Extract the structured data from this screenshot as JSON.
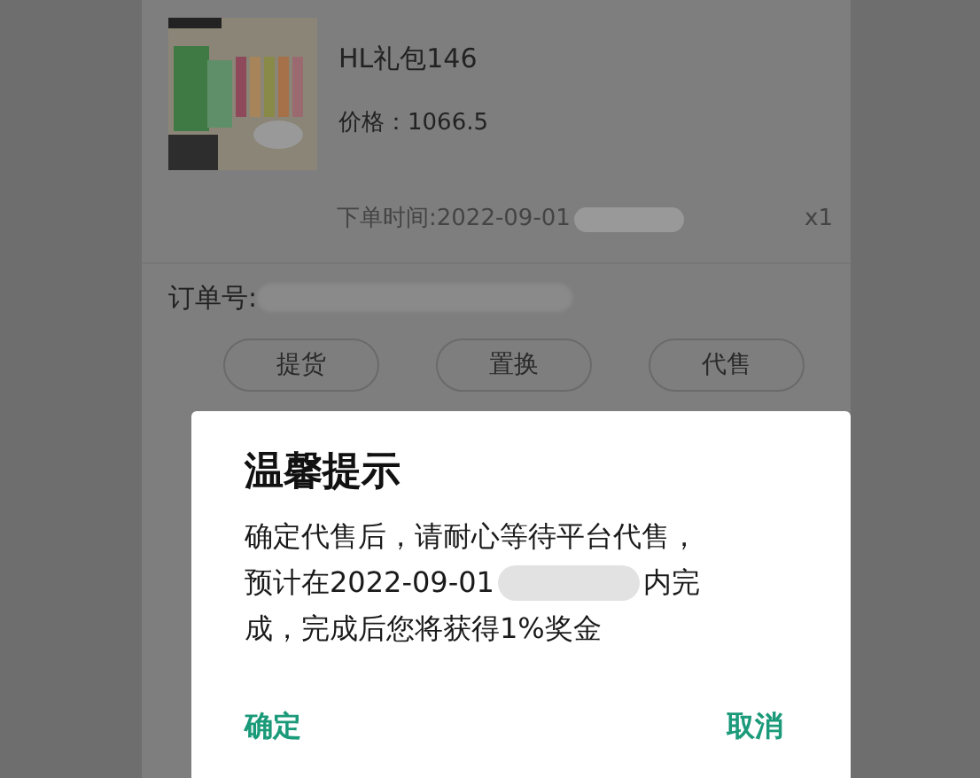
{
  "product": {
    "kind": "picture",
    "title": "HL礼包146",
    "price": "价格：1066.5",
    "order_time": "下单时间:2022-09-01",
    "quantity": "x1"
  },
  "order_number_label": "订单号:",
  "actions": [
    {
      "label": "提货"
    },
    {
      "label": "置换"
    },
    {
      "label": "代售"
    }
  ],
  "dialog": {
    "title": "温馨提示",
    "message_lines": [
      [
        "确定代售后，请耐心等待平台代售，"
      ],
      [
        "预计在2022-09-01",
        "内完"
      ],
      [
        "成，完成后您将获得1%奖金"
      ]
    ],
    "buttons": [
      {
        "label": "确定"
      },
      {
        "label": "取消"
      }
    ]
  }
}
